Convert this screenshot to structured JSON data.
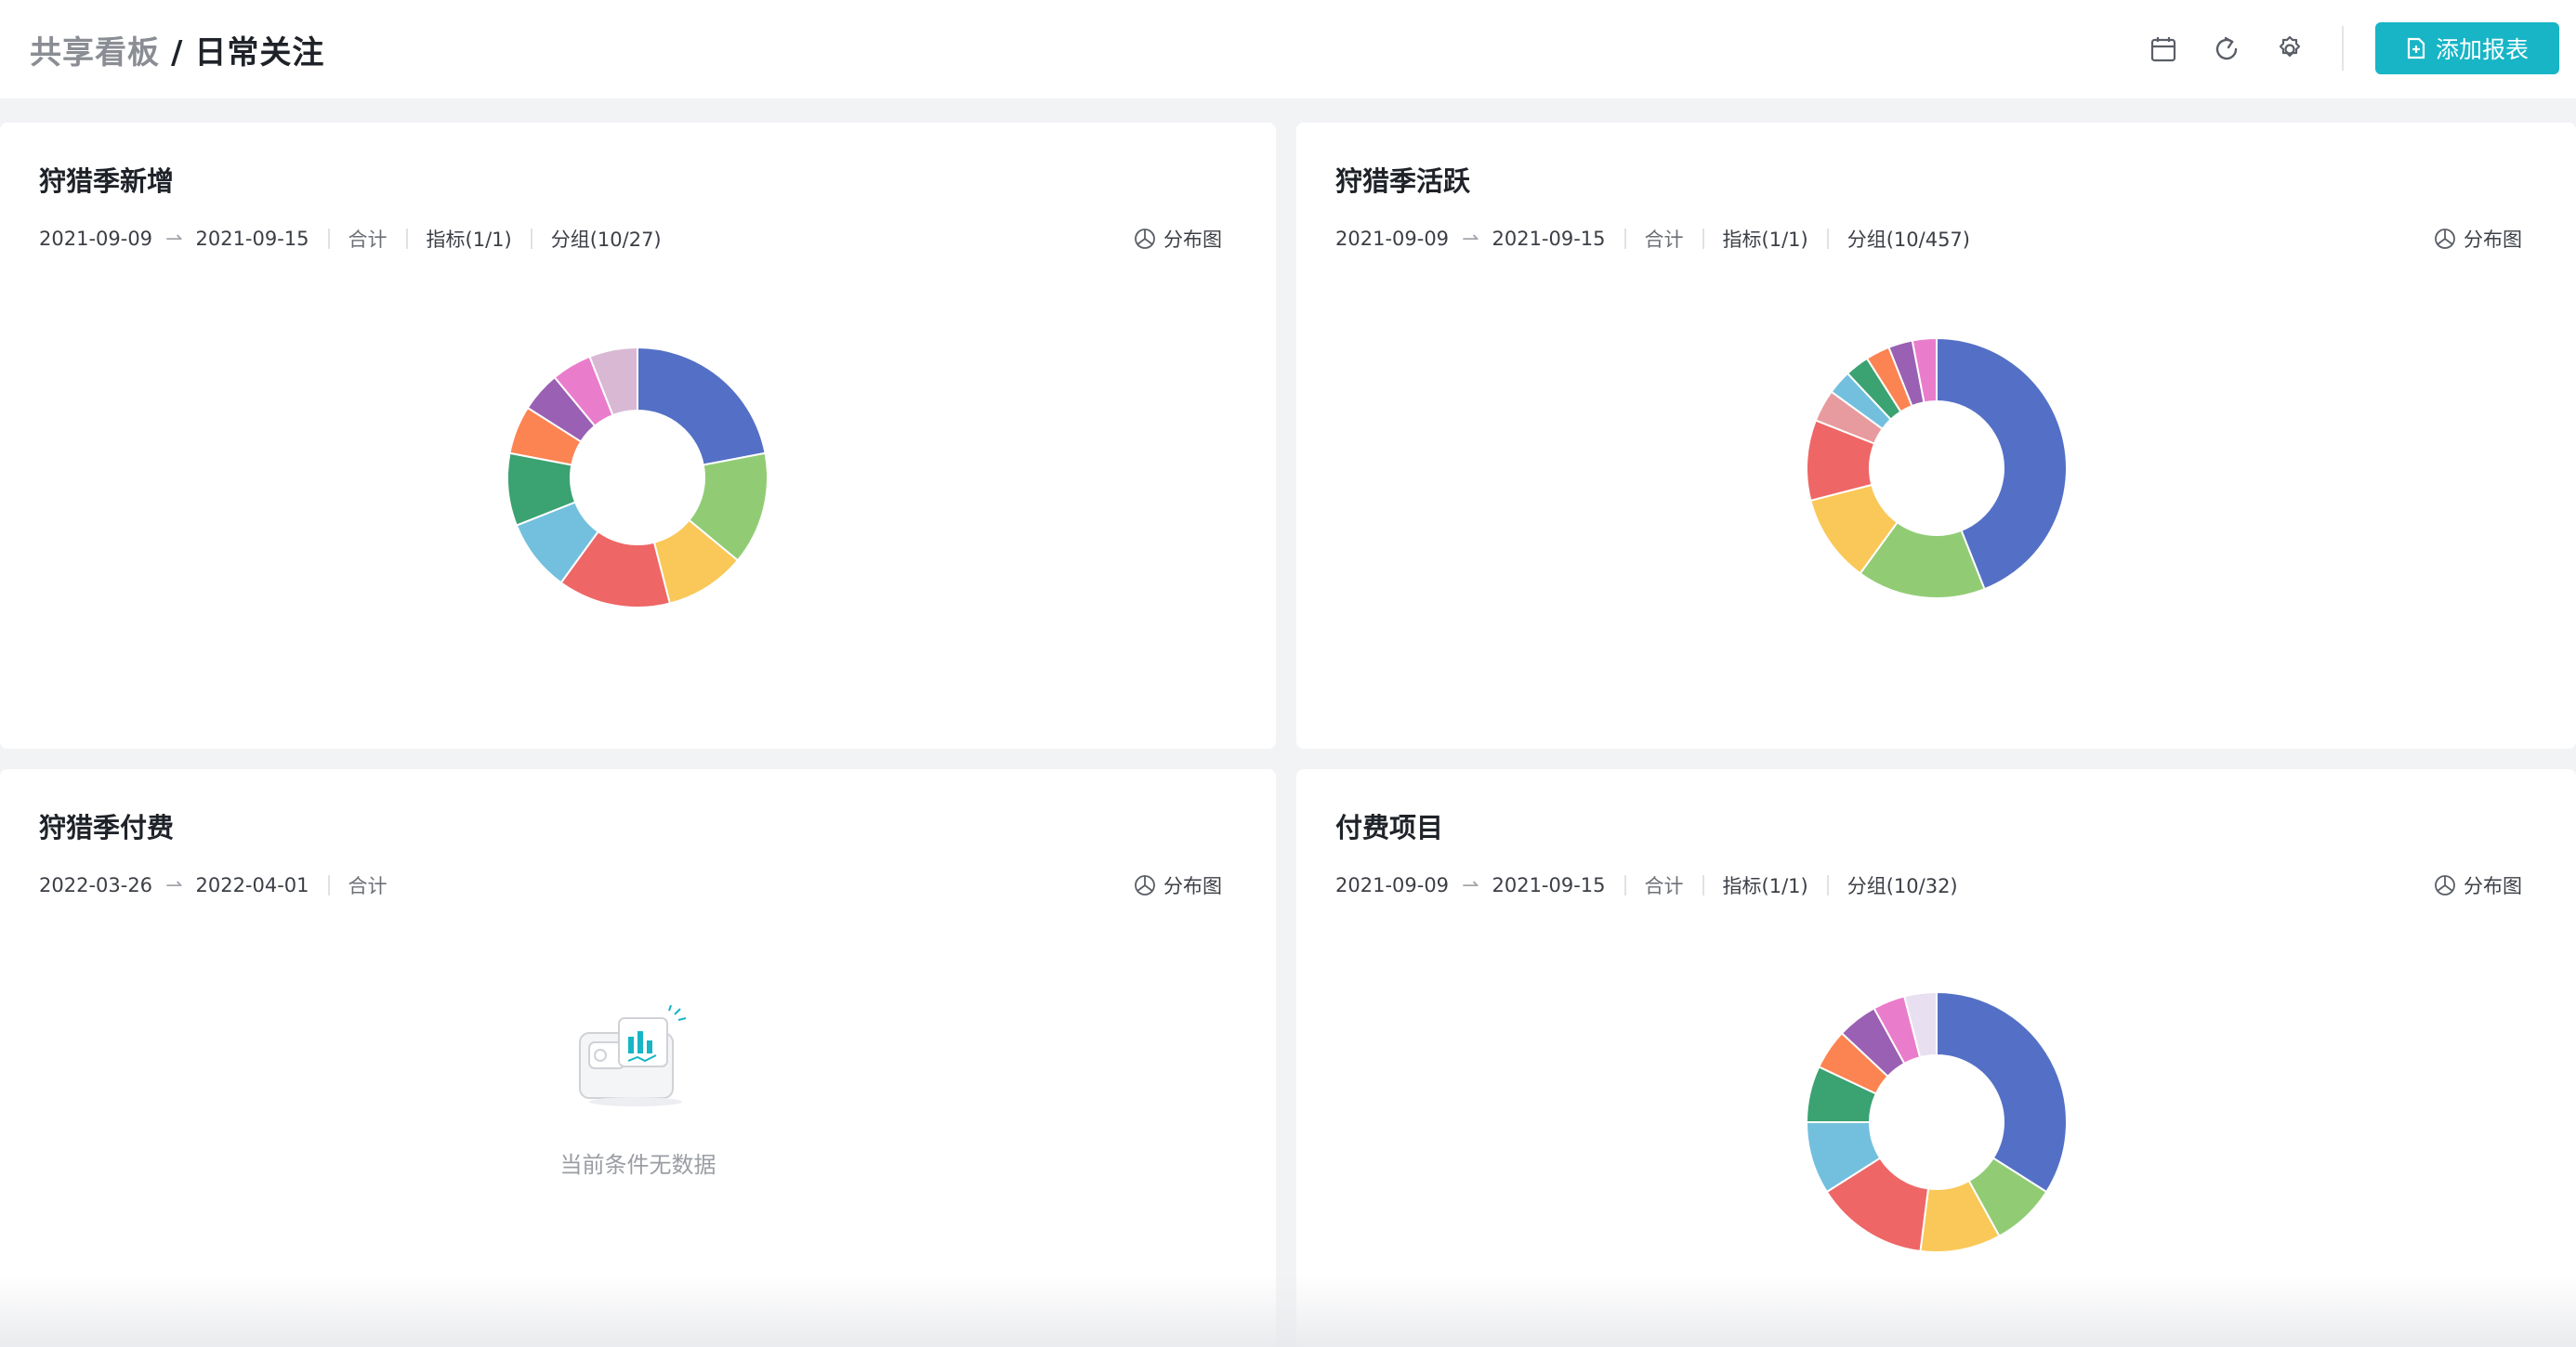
{
  "breadcrumb": {
    "parent": "共享看板",
    "separator": "/",
    "current": "日常关注"
  },
  "toolbar": {
    "icons": [
      "calendar-icon",
      "refresh-icon",
      "settings-icon"
    ],
    "add_button_label": "添加报表"
  },
  "colors": {
    "accent": "#17b5c6",
    "card_bg": "#ffffff",
    "page_bg": "#f2f3f5"
  },
  "cards": [
    {
      "title": "狩猎季新增",
      "date_start": "2021-09-09",
      "date_end": "2021-09-15",
      "aggregate": "合计",
      "metric": "指标(1/1)",
      "group": "分组(10/27)",
      "chart_type_label": "分布图",
      "has_data": true
    },
    {
      "title": "狩猎季活跃",
      "date_start": "2021-09-09",
      "date_end": "2021-09-15",
      "aggregate": "合计",
      "metric": "指标(1/1)",
      "group": "分组(10/457)",
      "chart_type_label": "分布图",
      "has_data": true
    },
    {
      "title": "狩猎季付费",
      "date_start": "2022-03-26",
      "date_end": "2022-04-01",
      "aggregate": "合计",
      "chart_type_label": "分布图",
      "has_data": false,
      "empty_text": "当前条件无数据"
    },
    {
      "title": "付费项目",
      "date_start": "2021-09-09",
      "date_end": "2021-09-15",
      "aggregate": "合计",
      "metric": "指标(1/1)",
      "group": "分组(10/32)",
      "chart_type_label": "分布图",
      "has_data": true
    }
  ],
  "chart_data": [
    {
      "type": "pie",
      "chart": "狩猎季新增",
      "donut": true,
      "slices": [
        {
          "color": "#5470c6",
          "value": 22
        },
        {
          "color": "#91cc75",
          "value": 14
        },
        {
          "color": "#fac858",
          "value": 10
        },
        {
          "color": "#ee6666",
          "value": 14
        },
        {
          "color": "#73c0de",
          "value": 9
        },
        {
          "color": "#3ba272",
          "value": 9
        },
        {
          "color": "#fc8452",
          "value": 6
        },
        {
          "color": "#9a60b4",
          "value": 5
        },
        {
          "color": "#ea7ccc",
          "value": 5
        },
        {
          "color": "#d9b8d4",
          "value": 6
        }
      ]
    },
    {
      "type": "pie",
      "chart": "狩猎季活跃",
      "donut": true,
      "slices": [
        {
          "color": "#5470c6",
          "value": 44
        },
        {
          "color": "#91cc75",
          "value": 16
        },
        {
          "color": "#fac858",
          "value": 11
        },
        {
          "color": "#ee6666",
          "value": 10
        },
        {
          "color": "#e89b9e",
          "value": 4
        },
        {
          "color": "#73c0de",
          "value": 3
        },
        {
          "color": "#3ba272",
          "value": 3
        },
        {
          "color": "#fc8452",
          "value": 3
        },
        {
          "color": "#9a60b4",
          "value": 3
        },
        {
          "color": "#ea7ccc",
          "value": 3
        }
      ]
    },
    {
      "type": "pie",
      "chart": "付费项目",
      "donut": true,
      "slices": [
        {
          "color": "#5470c6",
          "value": 34
        },
        {
          "color": "#91cc75",
          "value": 8
        },
        {
          "color": "#fac858",
          "value": 10
        },
        {
          "color": "#ee6666",
          "value": 14
        },
        {
          "color": "#73c0de",
          "value": 9
        },
        {
          "color": "#3ba272",
          "value": 7
        },
        {
          "color": "#fc8452",
          "value": 5
        },
        {
          "color": "#9a60b4",
          "value": 5
        },
        {
          "color": "#ea7ccc",
          "value": 4
        },
        {
          "color": "#e8dff0",
          "value": 4
        }
      ]
    }
  ]
}
